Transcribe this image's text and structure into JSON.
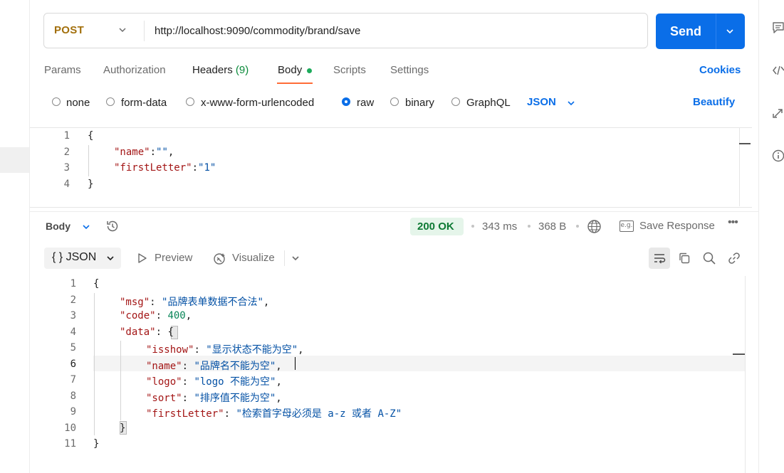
{
  "request": {
    "method": "POST",
    "url": "http://localhost:9090/commodity/brand/save",
    "send_label": "Send"
  },
  "request_tabs": {
    "params": "Params",
    "authorization": "Authorization",
    "headers": "Headers",
    "headers_count": "(9)",
    "body": "Body",
    "scripts": "Scripts",
    "settings": "Settings",
    "cookies": "Cookies"
  },
  "body_types": {
    "none": "none",
    "form_data": "form-data",
    "urlencoded": "x-www-form-urlencoded",
    "raw": "raw",
    "binary": "binary",
    "graphql": "GraphQL",
    "selected": "raw",
    "language": "JSON",
    "beautify": "Beautify"
  },
  "request_body": {
    "line_numbers": [
      "1",
      "2",
      "3",
      "4"
    ],
    "open_brace": "{",
    "close_brace": "}",
    "name_key": "\"name\"",
    "name_value": "\"\"",
    "first_key": "\"firstLetter\"",
    "first_value": "\"1\""
  },
  "response_bar": {
    "body_label": "Body",
    "status": "200 OK",
    "time": "343 ms",
    "size": "368 B",
    "save_response": "Save Response",
    "more": "•••"
  },
  "response_toolbar": {
    "format": "{ } JSON",
    "preview": "Preview",
    "visualize": "Visualize"
  },
  "response_body": {
    "line_numbers": [
      "1",
      "2",
      "3",
      "4",
      "5",
      "6",
      "7",
      "8",
      "9",
      "10",
      "11"
    ],
    "open_brace": "{",
    "close_brace": "}",
    "msg_key": "\"msg\"",
    "msg_value": "\"品牌表单数据不合法\"",
    "code_key": "\"code\"",
    "code_value": "400",
    "data_key": "\"data\"",
    "data_open": "{",
    "data_close": "}",
    "isshow_key": "\"isshow\"",
    "isshow_value": "\"显示状态不能为空\"",
    "name_key": "\"name\"",
    "name_value": "\"品牌名不能为空\"",
    "logo_key": "\"logo\"",
    "logo_value": "\"logo 不能为空\"",
    "sort_key": "\"sort\"",
    "sort_value": "\"排序值不能为空\"",
    "first_key": "\"firstLetter\"",
    "first_value": "\"检索首字母必须是 a-z 或者 A-Z\""
  },
  "icons": {
    "right_rail": [
      "comment-icon",
      "code-icon",
      "transform-icon",
      "info-icon"
    ]
  },
  "colors": {
    "accent": "#0a6ee8",
    "method": "#a26f0b",
    "status_ok": "#0d7a34",
    "json_key": "#a31515",
    "json_string": "#0451a5",
    "json_number": "#098658"
  }
}
